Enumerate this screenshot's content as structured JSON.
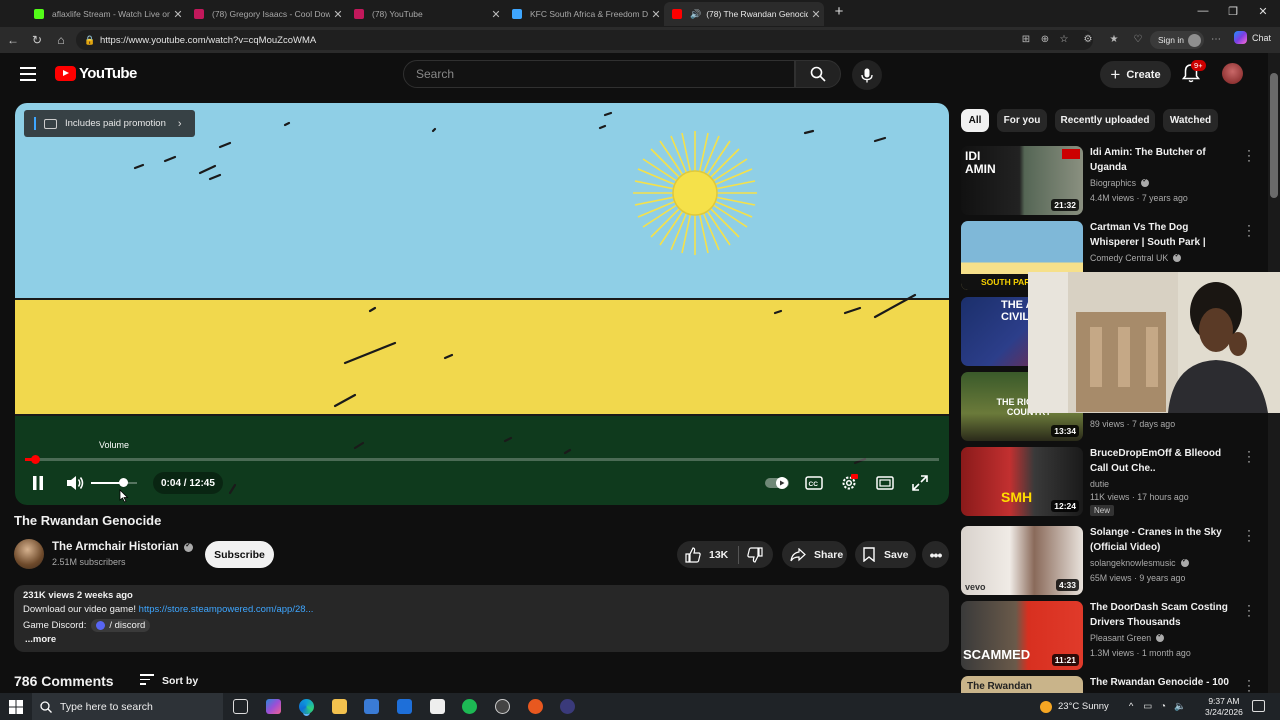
{
  "browser": {
    "tabs": [
      {
        "label": "aflaxlife Stream - Watch Live on K",
        "fav": "#53fc18"
      },
      {
        "label": "(78) Gregory Isaacs - Cool Down T",
        "fav": "#ff0000"
      },
      {
        "label": "(78) YouTube",
        "fav": "#ff0000"
      },
      {
        "label": "KFC South Africa & Freedom Drea",
        "fav": "#3ea6ff"
      },
      {
        "label": "(78) The Rwandan Genocide",
        "fav": "#ff0000"
      }
    ],
    "url": "https://www.youtube.com/watch?v=cqMouZcoWMA",
    "signin_label": "Sign in",
    "chat_label": "Chat"
  },
  "youtube": {
    "logo_text": "YouTube",
    "search_placeholder": "Search",
    "create_label": "Create",
    "notif_count": "9+"
  },
  "player": {
    "promo_label": "Includes paid promotion",
    "volume_tooltip": "Volume",
    "time": "0:04 / 12:45",
    "progress_fraction": 0.005,
    "volume_fraction": 0.7
  },
  "video": {
    "title": "The Rwandan Genocide",
    "channel": "The Armchair Historian",
    "subscribers": "2.51M subscribers",
    "subscribe_label": "Subscribe",
    "likes": "13K",
    "share_label": "Share",
    "save_label": "Save",
    "stats": "231K views  2 weeks ago",
    "desc_prefix": "Download our video game! ",
    "desc_link": "https://store.steampowered.com/app/28...",
    "discord_prefix": "Game Discord: ",
    "discord_chip": "/ discord",
    "more_label": "...more",
    "comments": "786 Comments",
    "sort_label": "Sort by"
  },
  "chips": [
    "All",
    "For you",
    "Recently uploaded",
    "Watched"
  ],
  "recommendations": [
    {
      "title": "Idi Amin: The Butcher of Uganda",
      "channel": "Biographics",
      "verified": true,
      "meta": "4.4M views · 7 years ago",
      "duration": "21:32",
      "thumb_text": "IDI AMIN"
    },
    {
      "title": "Cartman Vs The Dog Whisperer | South Park | Comedy Central ...",
      "channel": "Comedy Central UK",
      "verified": true,
      "meta": "",
      "duration": "",
      "thumb_text": "SOUTH PARK"
    },
    {
      "title": "",
      "channel": "",
      "verified": false,
      "meta": "",
      "duration": "",
      "thumb_text": "THE AME CIVIL"
    },
    {
      "title": "",
      "channel": "",
      "verified": false,
      "meta": "89 views · 7 days ago",
      "duration": "13:34",
      "thumb_text": "THE RIC POOR COUNTRY"
    },
    {
      "title": "BruceDropEmOff & Blleood Call Out Che..",
      "channel": "dutie",
      "verified": false,
      "meta": "11K views · 17 hours ago",
      "duration": "12:24",
      "thumb_text": "SMH",
      "badge": "New"
    },
    {
      "title": "Solange - Cranes in the Sky (Official Video)",
      "channel": "solangeknowlesmusic",
      "verified": true,
      "meta": "65M views · 9 years ago",
      "duration": "4:33",
      "thumb_text": "vevo"
    },
    {
      "title": "The DoorDash Scam Costing Drivers Thousands",
      "channel": "Pleasant Green",
      "verified": true,
      "meta": "1.3M views · 1 month ago",
      "duration": "11:21",
      "thumb_text": "SCAMMED"
    },
    {
      "title": "The Rwandan Genocide - 100",
      "channel": "",
      "verified": false,
      "meta": "",
      "duration": "",
      "thumb_text": "The Rwandan"
    }
  ],
  "taskbar": {
    "search_placeholder": "Type here to search",
    "weather": "23°C  Sunny",
    "time": "9:37 AM",
    "date": "3/24/2026"
  }
}
